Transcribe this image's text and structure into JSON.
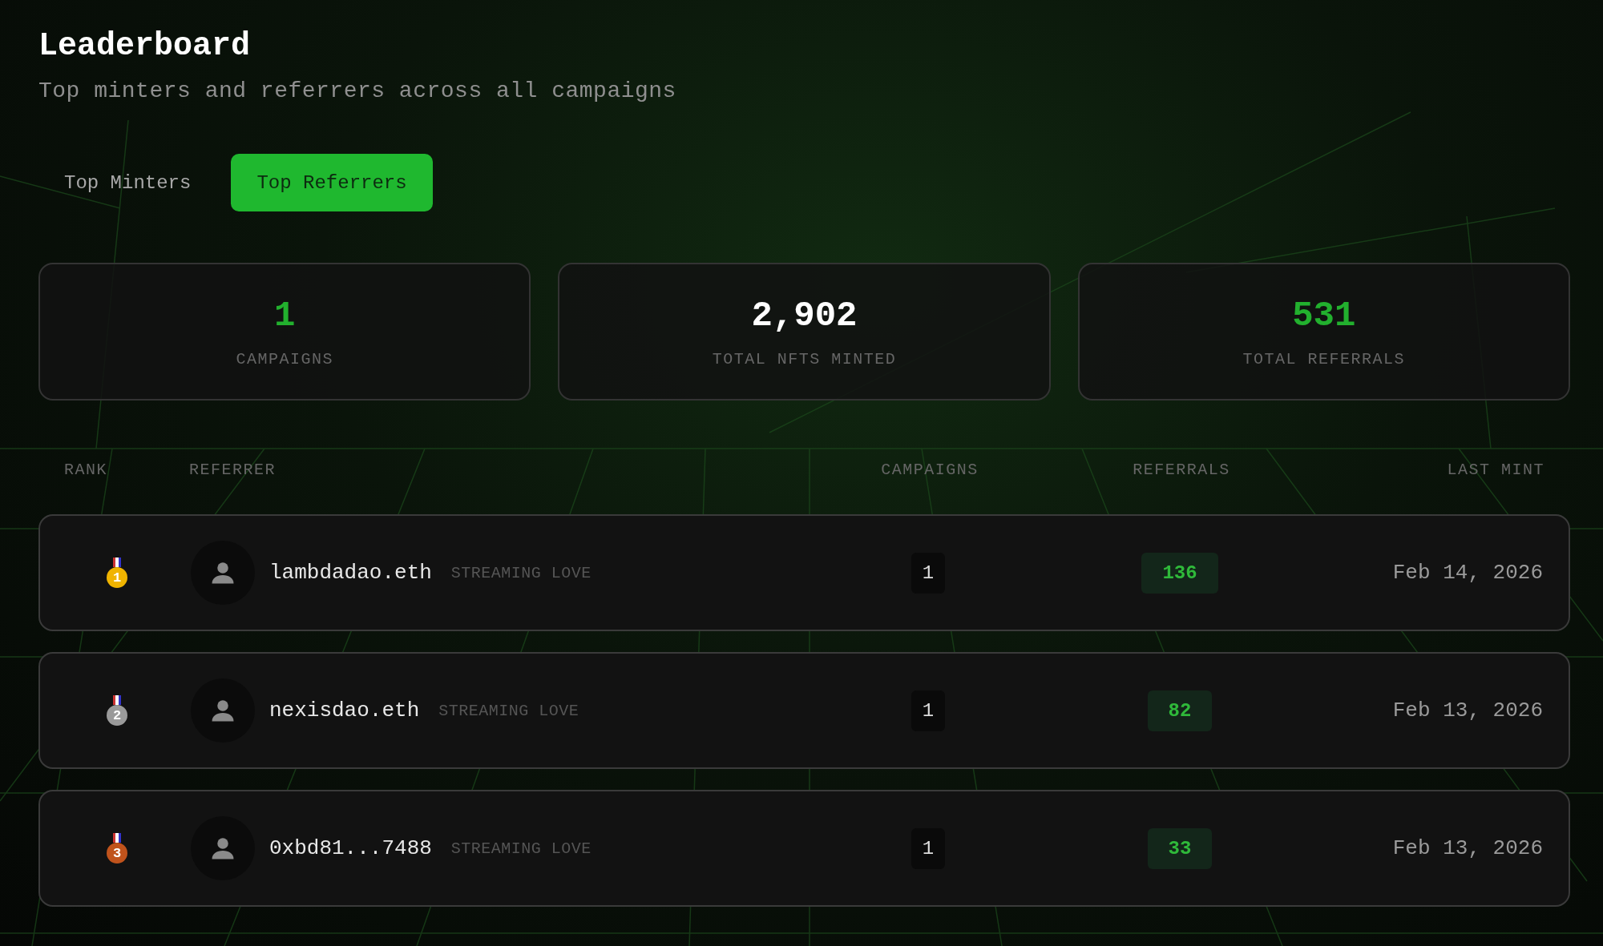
{
  "header": {
    "title": "Leaderboard",
    "subtitle": "Top minters and referrers across all campaigns"
  },
  "tabs": [
    {
      "label": "Top Minters",
      "selected": false
    },
    {
      "label": "Top Referrers",
      "selected": true
    }
  ],
  "stats": [
    {
      "value": "1",
      "label": "CAMPAIGNS",
      "highlight": true
    },
    {
      "value": "2,902",
      "label": "TOTAL NFTS MINTED",
      "highlight": false
    },
    {
      "value": "531",
      "label": "TOTAL REFERRALS",
      "highlight": true
    }
  ],
  "table": {
    "columns": [
      "RANK",
      "REFERRER",
      "CAMPAIGNS",
      "REFERRALS",
      "LAST MINT"
    ],
    "rows": [
      {
        "rank": "1",
        "color": "#f0b400",
        "name": "lambdadao.eth",
        "campaign": "STREAMING LOVE",
        "campaigns": "1",
        "referrals": "136",
        "last_mint": "Feb 14, 2026"
      },
      {
        "rank": "2",
        "color": "#9a9a9a",
        "name": "nexisdao.eth",
        "campaign": "STREAMING LOVE",
        "campaigns": "1",
        "referrals": "82",
        "last_mint": "Feb 13, 2026"
      },
      {
        "rank": "3",
        "color": "#c0531c",
        "name": "0xbd81...7488",
        "campaign": "STREAMING LOVE",
        "campaigns": "1",
        "referrals": "33",
        "last_mint": "Feb 13, 2026"
      }
    ]
  }
}
